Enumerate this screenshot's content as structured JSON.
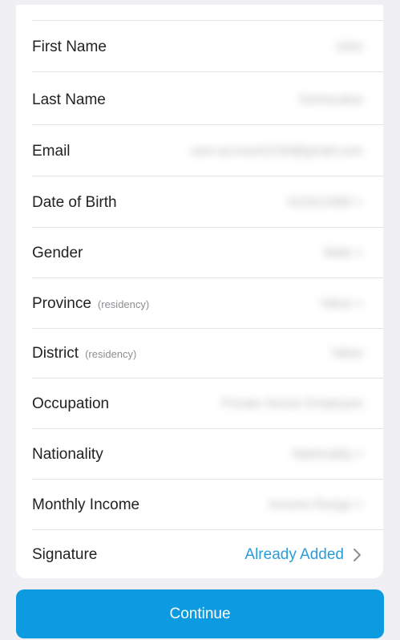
{
  "form": {
    "rows": [
      {
        "label": "First Name",
        "hint": "",
        "value": "John"
      },
      {
        "label": "Last Name",
        "hint": "",
        "value": "Somevalue"
      },
      {
        "label": "Email",
        "hint": "",
        "value": "user.account1234@gmail.com"
      },
      {
        "label": "Date of Birth",
        "hint": "",
        "value": "01/01/1990 >"
      },
      {
        "label": "Gender",
        "hint": "",
        "value": "Male >"
      },
      {
        "label": "Province",
        "hint": "(residency)",
        "value": "Value >"
      },
      {
        "label": "District",
        "hint": "(residency)",
        "value": "Value"
      },
      {
        "label": "Occupation",
        "hint": "",
        "value": "Private Sector Employee"
      },
      {
        "label": "Nationality",
        "hint": "",
        "value": "Nationality >"
      },
      {
        "label": "Monthly Income",
        "hint": "",
        "value": "Income Range >"
      }
    ],
    "signature": {
      "label": "Signature",
      "status": "Already Added"
    }
  },
  "footer": {
    "continue_label": "Continue"
  },
  "colors": {
    "background": "#efeff4",
    "card": "#ffffff",
    "link": "#2a9dd8",
    "primary_button": "#0c9be0"
  },
  "icons": {
    "signature_chevron": "chevron-right-icon"
  }
}
